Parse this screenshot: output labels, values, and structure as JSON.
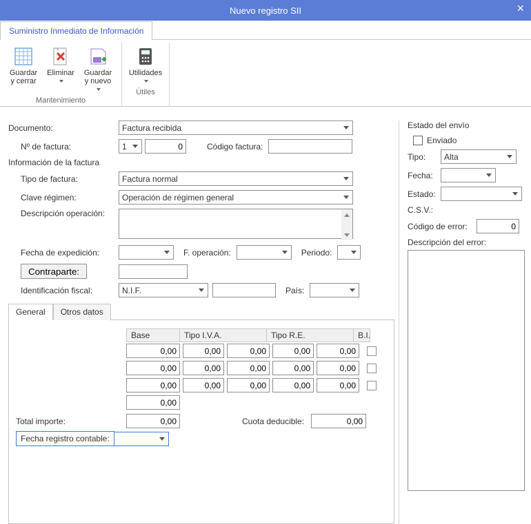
{
  "window": {
    "title": "Nuevo registro SII"
  },
  "ribbon": {
    "tab_label": "Suministro Inmediato de Información",
    "group_mantenimiento": "Mantenimiento",
    "group_utiles": "Útiles",
    "btn_guardar_cerrar_l1": "Guardar",
    "btn_guardar_cerrar_l2": "y cerrar",
    "btn_eliminar_l1": "Eliminar",
    "btn_eliminar_l2": "",
    "btn_guardar_nuevo_l1": "Guardar",
    "btn_guardar_nuevo_l2": "y nuevo",
    "btn_utilidades_l1": "Utilidades",
    "btn_utilidades_l2": ""
  },
  "form": {
    "documento_label": "Documento:",
    "documento_value": "Factura recibida",
    "n_factura_label": "Nº de factura:",
    "n_factura_serie": "1",
    "n_factura_num": "0",
    "codigo_factura_label": "Código factura:",
    "codigo_factura_value": "",
    "info_factura_title": "Información de la factura",
    "tipo_factura_label": "Tipo de factura:",
    "tipo_factura_value": "Factura normal",
    "clave_regimen_label": "Clave régimen:",
    "clave_regimen_value": "Operación de régimen general",
    "desc_operacion_label": "Descripción operación:",
    "desc_operacion_value": "",
    "fecha_exp_label": "Fecha de expedición:",
    "fecha_exp_value": "",
    "f_operacion_label": "F. operación:",
    "f_operacion_value": "",
    "periodo_label": "Periodo:",
    "periodo_value": "",
    "contraparte_btn": "Contraparte:",
    "contraparte_value": "",
    "ident_fiscal_label": "Identificación fiscal:",
    "ident_fiscal_type": "N.I.F.",
    "ident_fiscal_value": "",
    "pais_label": "País:",
    "pais_value": ""
  },
  "tabs": {
    "general": "General",
    "otros": "Otros datos"
  },
  "grid": {
    "head_base": "Base",
    "head_tipo_iva": "Tipo I.V.A.",
    "head_tipo_re": "Tipo R.E.",
    "head_bi": "B.I.",
    "rows": [
      {
        "base": "0,00",
        "iva_pct": "0,00",
        "iva_cu": "0,00",
        "re_pct": "0,00",
        "re_cu": "0,00"
      },
      {
        "base": "0,00",
        "iva_pct": "0,00",
        "iva_cu": "0,00",
        "re_pct": "0,00",
        "re_cu": "0,00"
      },
      {
        "base": "0,00",
        "iva_pct": "0,00",
        "iva_cu": "0,00",
        "re_pct": "0,00",
        "re_cu": "0,00"
      }
    ],
    "subtotal": "0,00",
    "total_importe_label": "Total importe:",
    "total_importe_value": "0,00",
    "cuota_deducible_label": "Cuota deducible:",
    "cuota_deducible_value": "0,00",
    "fecha_registro_label": "Fecha registro contable:",
    "fecha_registro_value": ""
  },
  "envio": {
    "title": "Estado del envío",
    "enviado_label": "Enviado",
    "tipo_label": "Tipo:",
    "tipo_value": "Alta",
    "fecha_label": "Fecha:",
    "fecha_value": "",
    "estado_label": "Estado:",
    "estado_value": "",
    "csv_label": "C.S.V.:",
    "codigo_error_label": "Código de error:",
    "codigo_error_value": "0",
    "desc_error_label": "Descripción del error:"
  }
}
